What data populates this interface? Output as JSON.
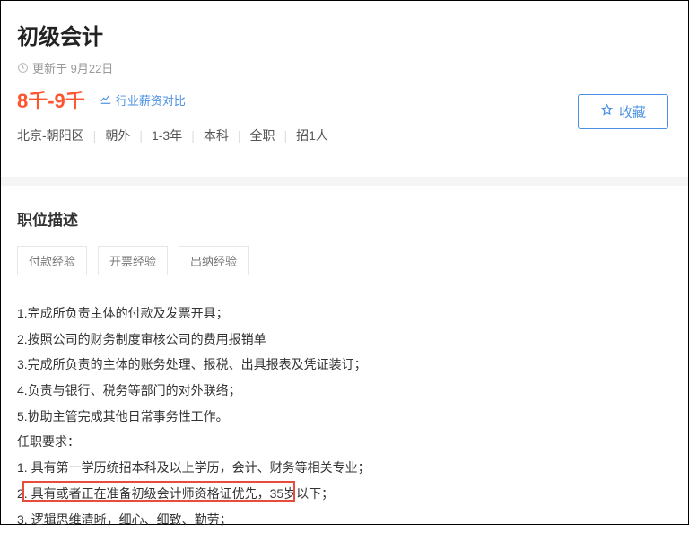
{
  "job": {
    "title": "初级会计",
    "updated_label": "更新于 9月22日",
    "salary": "8千-9千",
    "salary_compare_label": "行业薪资对比",
    "meta": {
      "location": "北京-朝阳区",
      "area": "朝外",
      "experience": "1-3年",
      "education": "本科",
      "type": "全职",
      "headcount": "招1人"
    },
    "favorite_label": "收藏"
  },
  "section": {
    "description_title": "职位描述"
  },
  "tags": [
    "付款经验",
    "开票经验",
    "出纳经验"
  ],
  "description_items": [
    "1.完成所负责主体的付款及发票开具；",
    "2.按照公司的财务制度审核公司的费用报销单",
    "3.完成所负责的主体的账务处理、报税、出具报表及凭证装订；",
    "4.负责与银行、税务等部门的对外联络；",
    "5.协助主管完成其他日常事务性工作。"
  ],
  "requirements_title": "任职要求：",
  "requirement_items": [
    {
      "num": "1. ",
      "text": "具有第一学历统招本科及以上学历，会计、财务等相关专业；",
      "suffix": ""
    },
    {
      "num": "2. ",
      "text": "具有或者正在准备初级会计师资格证优先",
      "suffix": "，35岁以下；"
    },
    {
      "num": "3. ",
      "text": "逻辑思维清晰，细心、细致、勤劳；",
      "suffix": ""
    }
  ]
}
